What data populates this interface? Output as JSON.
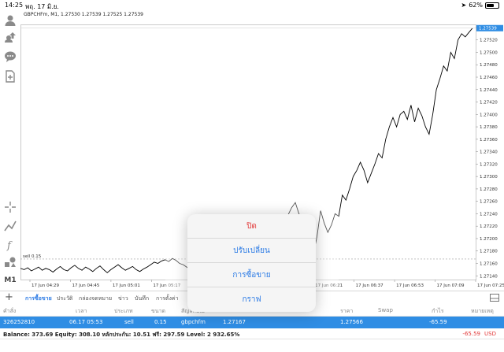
{
  "status_bar": {
    "time": "14:25",
    "date": "พฤ. 17 มิ.ย.",
    "battery": "62%",
    "battery_level": 0.62
  },
  "chart": {
    "title": "GBPCHFm, M1, 1.27530 1.27539 1.27525 1.27539",
    "current_price": "1.27539",
    "trade_line_label": "sell 0.15",
    "colors": {
      "line": "#000000",
      "grid": "#dcdcdc",
      "trade_line": "#9a9a9a",
      "price_tag": "#2f8de4"
    }
  },
  "chart_data": {
    "type": "line",
    "x_ticks": [
      "17 Jun 04:29",
      "17 Jun 04:45",
      "17 Jun 05:01",
      "17 Jun 05:17",
      "17 Jun 05:33",
      "17 Jun 05:49",
      "17 Jun 06:05",
      "17 Jun 06:21",
      "17 Jun 06:37",
      "17 Jun 06:53",
      "17 Jun 07:09",
      "17 Jun 07:25"
    ],
    "y_ticks": [
      "1.27560",
      "1.27540",
      "1.27520",
      "1.27500",
      "1.27480",
      "1.27460",
      "1.27440",
      "1.27420",
      "1.27400",
      "1.27380",
      "1.27360",
      "1.27340",
      "1.27320",
      "1.27300",
      "1.27280",
      "1.27260",
      "1.27240",
      "1.27220",
      "1.27200",
      "1.27180",
      "1.27160",
      "1.27140"
    ],
    "ylim": [
      1.27134,
      1.27545
    ],
    "trade_price": 1.27167,
    "values": [
      1.27152,
      1.2715,
      1.27153,
      1.27148,
      1.27151,
      1.27154,
      1.27149,
      1.27152,
      1.2715,
      1.27146,
      1.27151,
      1.27155,
      1.2715,
      1.27148,
      1.27153,
      1.27157,
      1.27152,
      1.27149,
      1.27154,
      1.27151,
      1.27147,
      1.27152,
      1.27156,
      1.2715,
      1.27145,
      1.2715,
      1.27154,
      1.27158,
      1.27153,
      1.27149,
      1.27152,
      1.27155,
      1.2715,
      1.27147,
      1.27151,
      1.27154,
      1.27158,
      1.27162,
      1.2716,
      1.27164,
      1.27166,
      1.27163,
      1.27168,
      1.27165,
      1.2716,
      1.27158,
      1.27154,
      1.2715,
      1.27146,
      1.2715,
      1.27148,
      1.27152,
      1.27156,
      1.2716,
      1.27164,
      1.2717,
      1.27175,
      1.2718,
      1.27185,
      1.2719,
      1.27195,
      1.272,
      1.27205,
      1.2721,
      1.27215,
      1.27218,
      1.27222,
      1.27226,
      1.2723,
      1.27232,
      1.27234,
      1.27233,
      1.27232,
      1.27234,
      1.27238,
      1.2725,
      1.27258,
      1.2724,
      1.2723,
      1.27215,
      1.2719,
      1.27175,
      1.27203,
      1.27245,
      1.27225,
      1.2721,
      1.27222,
      1.2724,
      1.27236,
      1.2727,
      1.27262,
      1.2728,
      1.273,
      1.2731,
      1.27323,
      1.2731,
      1.2729,
      1.27305,
      1.2732,
      1.27337,
      1.2733,
      1.2736,
      1.2738,
      1.27395,
      1.2738,
      1.274,
      1.27405,
      1.27392,
      1.27415,
      1.27388,
      1.2741,
      1.27398,
      1.2738,
      1.27368,
      1.274,
      1.2744,
      1.27458,
      1.27478,
      1.2747,
      1.275,
      1.2749,
      1.2752,
      1.2753,
      1.27525,
      1.27532,
      1.27539
    ]
  },
  "left_tools": [
    {
      "name": "profile-icon"
    },
    {
      "name": "signals-icon"
    },
    {
      "name": "chat-icon"
    },
    {
      "name": "new-order-icon"
    },
    {
      "name": "crosshair-icon"
    },
    {
      "name": "indicators-icon"
    },
    {
      "name": "function-icon"
    },
    {
      "name": "objects-icon"
    }
  ],
  "timeframe": "M1",
  "tabs": [
    {
      "label": "การซื้อขาย",
      "active": true
    },
    {
      "label": "ประวัติ",
      "active": false
    },
    {
      "label": "กล่องจดหมาย",
      "active": false
    },
    {
      "label": "ข่าว",
      "active": false
    },
    {
      "label": "บันทึก",
      "active": false
    },
    {
      "label": "การตั้งค่า",
      "active": false
    }
  ],
  "columns": [
    "คำสั่ง",
    "เวลา",
    "ประเภท",
    "ขนาด",
    "สัญลักษณ์",
    "ราคา",
    "Swap",
    "กำไร",
    "หมายเหตุ"
  ],
  "position_row": {
    "order": "326252810",
    "time": "06.17 05:53",
    "type": "sell",
    "volume": "0.15",
    "symbol": "gbpchfm",
    "open_price": "1.27167",
    "price": "1.27566",
    "profit": "-65.59"
  },
  "balance": {
    "text": "Balance: 373.69 Equity: 308.10 หลักประกัน: 10.51 ฟรี: 297.59 Level: 2 932.65%",
    "pl": "-65.59",
    "currency": "USD"
  },
  "popover": {
    "items": [
      {
        "label": "ปิด",
        "style": "danger"
      },
      {
        "label": "ปรับเปลี่ยน",
        "style": "normal"
      },
      {
        "label": "การซื้อขาย",
        "style": "normal"
      },
      {
        "label": "กราฟ",
        "style": "normal"
      }
    ]
  }
}
